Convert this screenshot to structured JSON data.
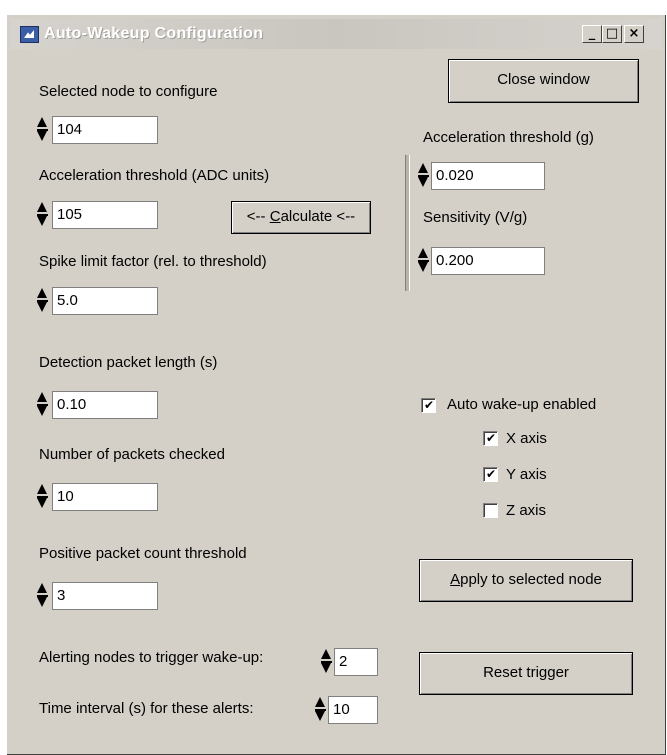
{
  "window": {
    "title": "Auto-Wakeup Configuration",
    "minimize_label": "_",
    "maximize_label": "□",
    "close_label": "×"
  },
  "left": {
    "node": {
      "label": "Selected node to configure",
      "value": "104"
    },
    "accel_adc": {
      "label": "Acceleration threshold (ADC units)",
      "value": "105"
    },
    "calculate_button": {
      "prefix": "<-- ",
      "accel": "C",
      "rest": "alculate <--"
    },
    "spike": {
      "label": "Spike limit factor (rel. to threshold)",
      "value": "5.0"
    },
    "packet_length": {
      "label": "Detection packet length (s)",
      "value": "0.10"
    },
    "packets_checked": {
      "label": "Number of packets checked",
      "value": "10"
    },
    "positive_count": {
      "label": "Positive packet count threshold",
      "value": "3"
    },
    "alerting_nodes": {
      "label": "Alerting nodes to trigger wake-up:",
      "value": "2"
    },
    "time_interval": {
      "label": "Time interval (s) for these alerts:",
      "value": "10"
    }
  },
  "right": {
    "close_button": "Close window",
    "accel_g": {
      "label": "Acceleration threshold (g)",
      "value": "0.020"
    },
    "sensitivity": {
      "label": "Sensitivity (V/g)",
      "value": "0.200"
    },
    "auto_wakeup": {
      "label": "Auto wake-up enabled",
      "checked": true
    },
    "x_axis": {
      "label": "X axis",
      "checked": true
    },
    "y_axis": {
      "label": "Y axis",
      "checked": true
    },
    "z_axis": {
      "label": "Z axis",
      "checked": false
    },
    "apply_button": {
      "accel": "A",
      "rest": "pply to selected node"
    },
    "reset_button": "Reset trigger"
  },
  "check_glyph": "✔"
}
